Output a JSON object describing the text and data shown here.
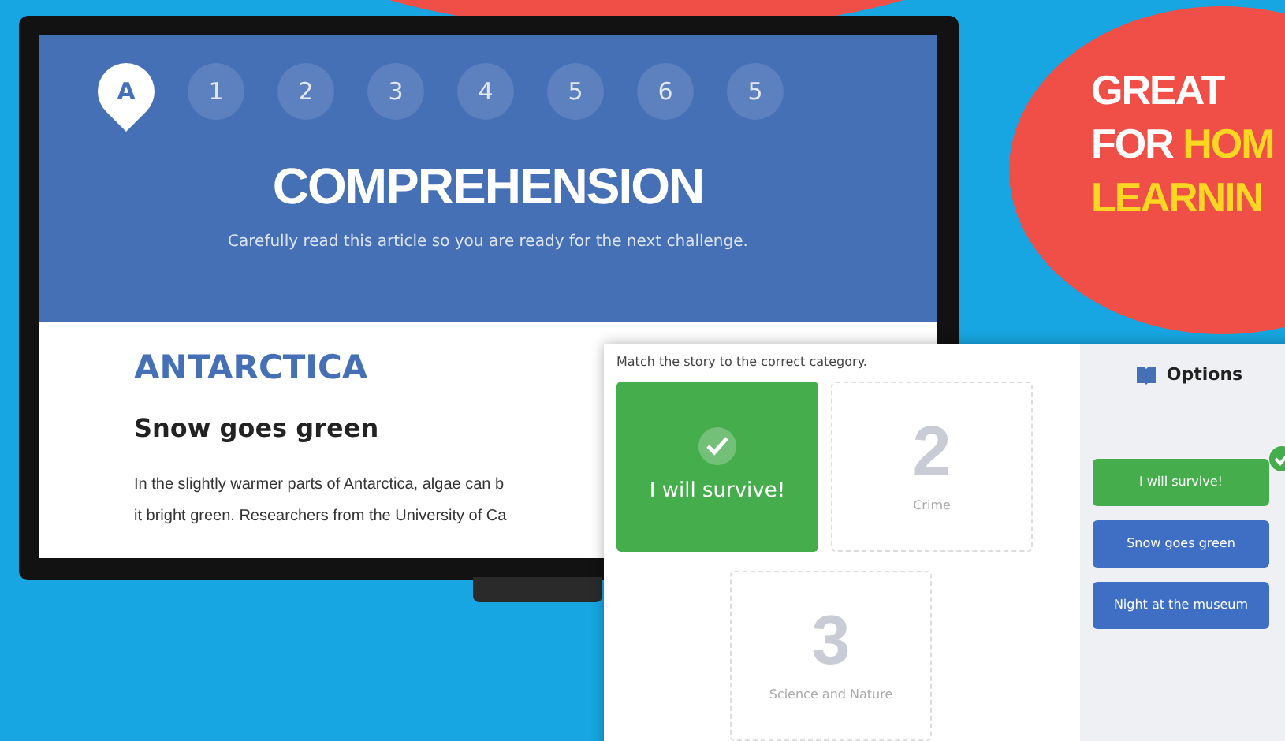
{
  "lesson_window": {
    "steps": [
      {
        "label": "A",
        "selected": true
      },
      {
        "label": "1",
        "selected": false
      },
      {
        "label": "2",
        "selected": false
      },
      {
        "label": "3",
        "selected": false
      },
      {
        "label": "4",
        "selected": false
      },
      {
        "label": "5",
        "selected": false
      },
      {
        "label": "6",
        "selected": false
      },
      {
        "label": "5",
        "selected": false
      }
    ],
    "title": "COMPREHENSION",
    "subtitle": "Carefully read this article so you are ready for the next challenge.",
    "topic": "ANTARCTICA",
    "heading": "Snow goes green",
    "body_lines": [
      "In the slightly warmer parts of Antarctica, algae can b",
      "it bright green. Researchers from the University of Ca"
    ]
  },
  "activity_window": {
    "instruction": "Match the story to the correct category.",
    "categories": [
      {
        "kind": "answered",
        "title": "I will survive!"
      },
      {
        "kind": "empty",
        "number": "2",
        "label": "Crime"
      },
      {
        "kind": "empty",
        "number": "3",
        "label": "Science and Nature"
      }
    ],
    "options": {
      "title": "Options",
      "items": [
        {
          "label": "I will survive!",
          "placed": true
        },
        {
          "label": "Snow goes green",
          "placed": false
        },
        {
          "label": "Night at the museum",
          "placed": false
        }
      ]
    }
  },
  "badge": {
    "lines": [
      [
        {
          "text": "GREAT",
          "highlight": false
        }
      ],
      [
        {
          "text": "FOR",
          "highlight": false
        },
        {
          "text": "HOM",
          "highlight": true
        }
      ],
      [
        {
          "text": "LEARNIN",
          "highlight": true
        }
      ]
    ]
  }
}
